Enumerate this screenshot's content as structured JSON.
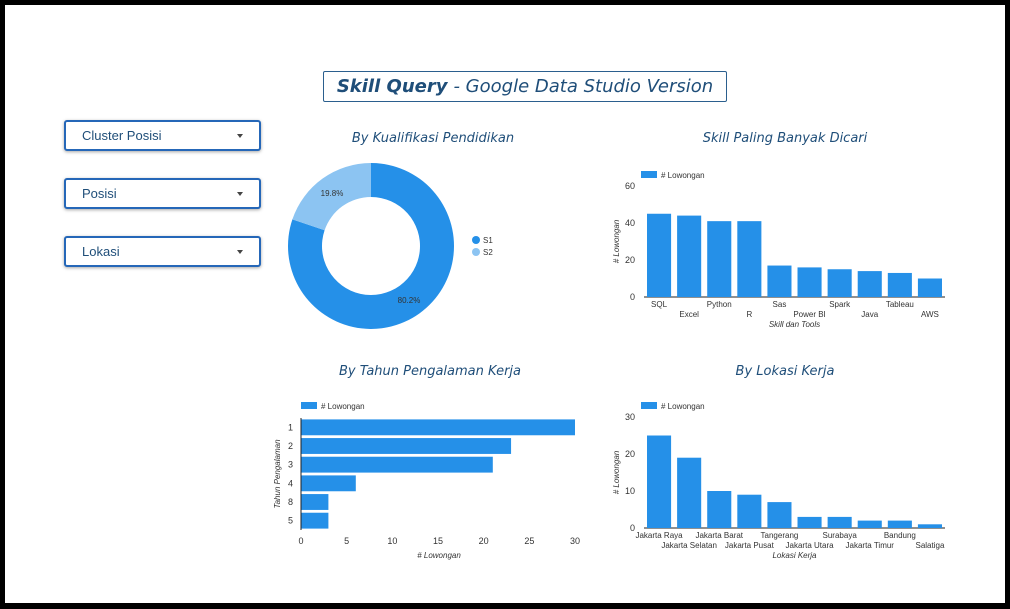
{
  "header": {
    "title_bold": "Skill Query",
    "title_rest": "- Google Data Studio Version"
  },
  "filters": [
    {
      "label": "Cluster Posisi"
    },
    {
      "label": "Posisi"
    },
    {
      "label": "Lokasi"
    }
  ],
  "colors": {
    "primary": "#2590e8",
    "secondary": "#8cc4f2",
    "title": "#1f4e79",
    "border": "#2567b8"
  },
  "icons": {
    "dropdown": "caret-down-icon"
  },
  "chart_data": [
    {
      "type": "pie",
      "title": "By Kualifikasi Pendidikan",
      "donut": true,
      "labels": [
        "S1",
        "S2"
      ],
      "values": [
        80.2,
        19.8
      ],
      "value_labels": [
        "80.2%",
        "19.8%"
      ],
      "legend": "right"
    },
    {
      "type": "bar",
      "title": "Skill Paling Banyak Dicari",
      "categories": [
        "SQL",
        "Excel",
        "Python",
        "R",
        "Sas",
        "Power BI",
        "Spark",
        "Java",
        "Tableau",
        "AWS"
      ],
      "series": [
        {
          "name": "# Lowongan",
          "values": [
            45,
            44,
            41,
            41,
            17,
            16,
            15,
            14,
            13,
            10
          ]
        }
      ],
      "xlabel": "Skill dan Tools",
      "ylabel": "# Lowongan",
      "ylim": [
        0,
        60
      ],
      "yticks": [
        0,
        20,
        40,
        60
      ],
      "legend": "top-left",
      "grid": false
    },
    {
      "type": "bar",
      "orientation": "horizontal",
      "title": "By Tahun Pengalaman Kerja",
      "categories": [
        "1",
        "2",
        "3",
        "4",
        "8",
        "5"
      ],
      "series": [
        {
          "name": "# Lowongan",
          "values": [
            30,
            23,
            21,
            6,
            3,
            3
          ]
        }
      ],
      "xlabel": "# Lowongan",
      "ylabel": "Tahun Pengalaman",
      "xlim": [
        0,
        30
      ],
      "xticks": [
        0,
        5,
        10,
        15,
        20,
        25,
        30
      ],
      "legend": "top-left",
      "grid": false
    },
    {
      "type": "bar",
      "title": "By Lokasi Kerja",
      "categories": [
        "Jakarta Raya",
        "Jakarta Selatan",
        "Jakarta Barat",
        "Jakarta Pusat",
        "Tangerang",
        "Jakarta Utara",
        "Surabaya",
        "Jakarta Timur",
        "Bandung",
        "Salatiga"
      ],
      "series": [
        {
          "name": "# Lowongan",
          "values": [
            25,
            19,
            10,
            9,
            7,
            3,
            3,
            2,
            2,
            1
          ]
        }
      ],
      "xlabel": "Lokasi Kerja",
      "ylabel": "# Lowongan",
      "ylim": [
        0,
        30
      ],
      "yticks": [
        0,
        10,
        20,
        30
      ],
      "legend": "top-left",
      "grid": false
    }
  ]
}
